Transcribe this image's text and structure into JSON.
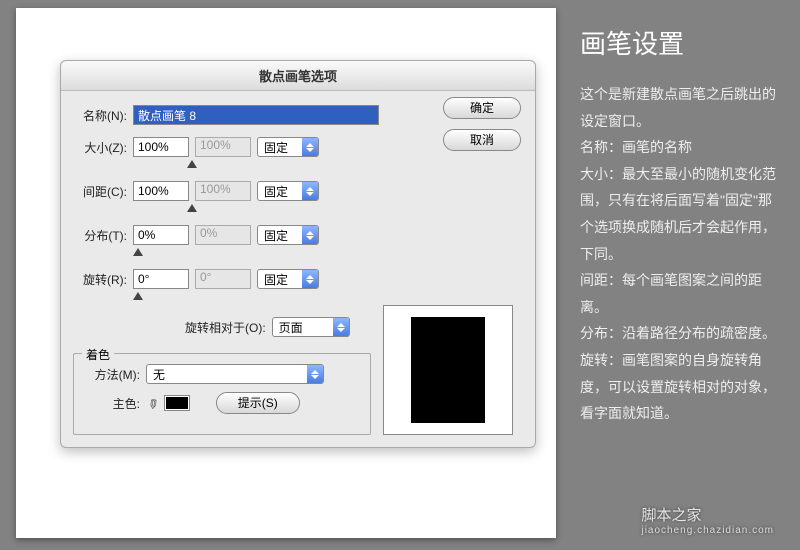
{
  "dialog": {
    "title": "散点画笔选项",
    "name_label": "名称(N):",
    "name_value": "散点画笔 8",
    "ok": "确定",
    "cancel": "取消",
    "params": {
      "size": {
        "label": "大小(Z):",
        "v1": "100%",
        "v2": "100%",
        "mode": "固定"
      },
      "spacing": {
        "label": "间距(C):",
        "v1": "100%",
        "v2": "100%",
        "mode": "固定"
      },
      "scatter": {
        "label": "分布(T):",
        "v1": "0%",
        "v2": "0%",
        "mode": "固定"
      },
      "rotation": {
        "label": "旋转(R):",
        "v1": "0°",
        "v2": "0°",
        "mode": "固定"
      }
    },
    "rot_rel_label": "旋转相对于(O):",
    "rot_rel_value": "页面",
    "tint": {
      "group": "着色",
      "method_label": "方法(M):",
      "method_value": "无",
      "key_label": "主色:",
      "hint": "提示(S)"
    }
  },
  "side": {
    "title": "画笔设置",
    "text": "这个是新建散点画笔之后跳出的设定窗口。\n名称：画笔的名称\n大小：最大至最小的随机变化范围，只有在将后面写着\"固定\"那个选项换成随机后才会起作用，下同。\n间距：每个画笔图案之间的距离。\n分布：沿着路径分布的疏密度。\n旋转：画笔图案的自身旋转角度，可以设置旋转相对的对象，看字面就知道。"
  },
  "watermark": {
    "brand": "脚本之家",
    "url": "jiaocheng.chazidian.com"
  }
}
